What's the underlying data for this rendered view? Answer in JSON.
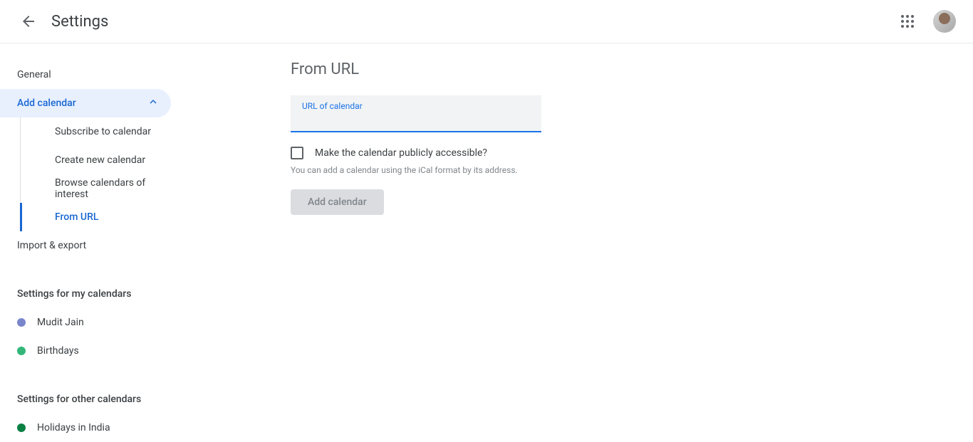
{
  "header": {
    "title": "Settings"
  },
  "sidebar": {
    "general": "General",
    "addCalendar": {
      "label": "Add calendar",
      "children": {
        "subscribe": "Subscribe to calendar",
        "create": "Create new calendar",
        "browse": "Browse calendars of interest",
        "fromUrl": "From URL"
      }
    },
    "importExport": "Import & export",
    "myCalendarsTitle": "Settings for my calendars",
    "myCalendars": [
      {
        "label": "Mudit Jain",
        "color": "#7986cb"
      },
      {
        "label": "Birthdays",
        "color": "#33b679"
      }
    ],
    "otherCalendarsTitle": "Settings for other calendars",
    "otherCalendars": [
      {
        "label": "Holidays in India",
        "color": "#0b8043"
      }
    ]
  },
  "main": {
    "title": "From URL",
    "inputLabel": "URL of calendar",
    "inputValue": "",
    "checkboxLabel": "Make the calendar publicly accessible?",
    "helpText": "You can add a calendar using the iCal format by its address.",
    "buttonLabel": "Add calendar"
  }
}
